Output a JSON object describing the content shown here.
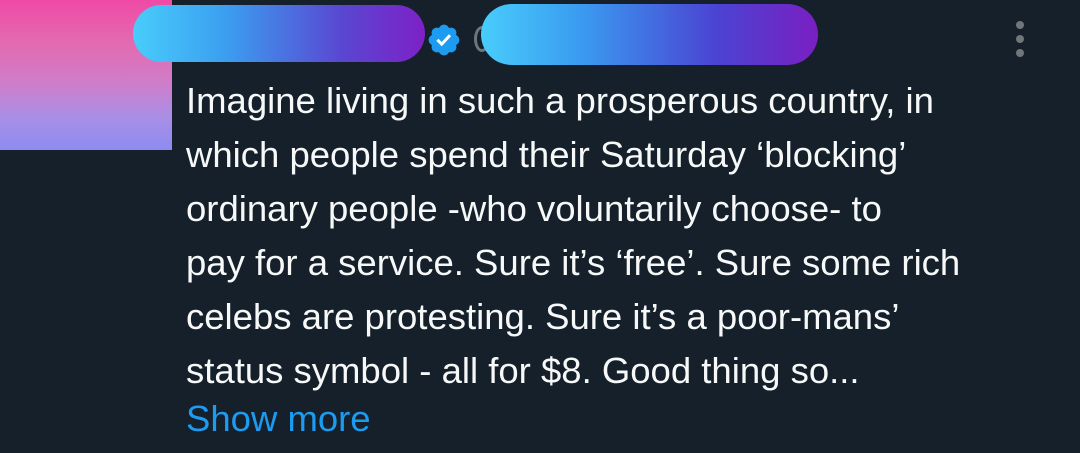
{
  "tweet": {
    "text_lines": [
      "Imagine living in such a prosperous country, in",
      "which people spend their Saturday ‘blocking’",
      "ordinary people -who voluntarily choose- to",
      "pay for a service. Sure it’s ‘free’. Sure some rich",
      "celebs are protesting. Sure it’s a poor-mans’",
      "status symbol - all for $8. Good thing so..."
    ],
    "show_more_label": "Show more",
    "author": {
      "name_redacted": true,
      "handle_redacted": true,
      "verified_icon": "verified-check-icon",
      "avatar_colors": [
        "#ef4aa6",
        "#8c8cf2"
      ]
    },
    "more_options_icon": "more-vertical-icon"
  },
  "theme": {
    "background": "#15202b",
    "text_color": "#f7f9f9",
    "accent": "#1d9bf0",
    "muted": "#71767b",
    "redaction_gradient": [
      "#48cdfb",
      "#7d21c6"
    ]
  }
}
